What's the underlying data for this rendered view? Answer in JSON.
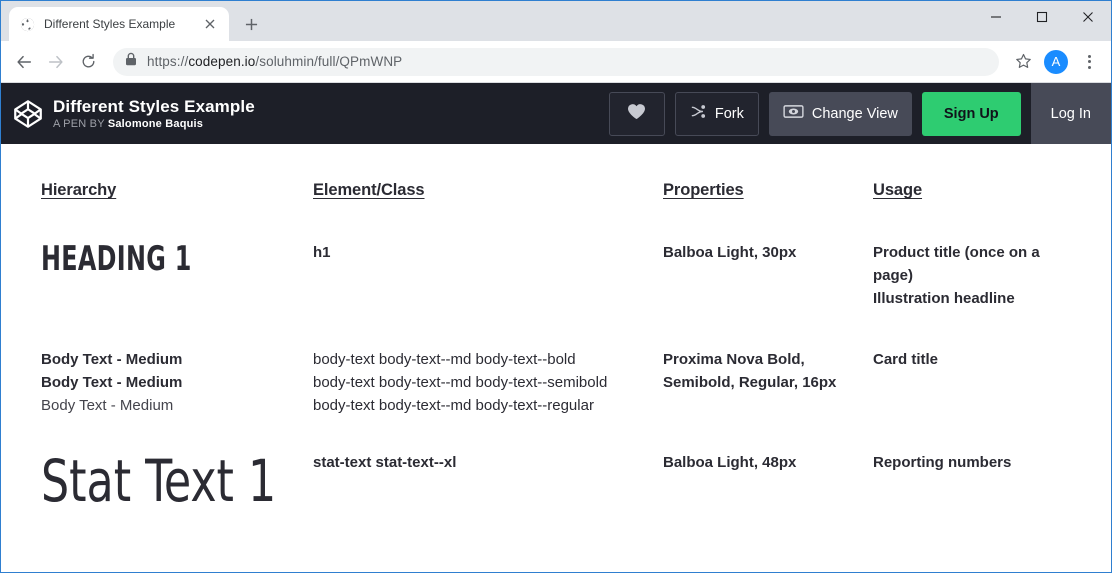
{
  "browser": {
    "tab": {
      "title": "Different Styles Example",
      "favicon_icon": "globe-icon",
      "close_icon": "close-icon"
    },
    "new_tab_icon": "plus-icon",
    "window_controls": {
      "minimize_icon": "minimize-icon",
      "maximize_icon": "maximize-icon",
      "close_icon": "window-close-icon"
    },
    "toolbar": {
      "back_icon": "back-arrow-icon",
      "forward_icon": "forward-arrow-icon",
      "reload_icon": "reload-icon",
      "lock_icon": "lock-icon",
      "url_scheme": "https://",
      "url_domain": "codepen.io",
      "url_path": "/soluhmin/full/QPmWNP",
      "url_full": "https://codepen.io/soluhmin/full/QPmWNP",
      "bookmark_icon": "star-icon",
      "avatar_letter": "A",
      "menu_icon": "kebab-menu-icon"
    }
  },
  "codepen_header": {
    "logo_icon": "codepen-logo-icon",
    "title": "Different Styles Example",
    "byline_prefix": "A PEN BY",
    "author": "Salomone Baquis",
    "actions": {
      "heart_icon": "heart-icon",
      "fork_icon": "fork-icon",
      "fork_label": "Fork",
      "change_view_icon": "eye-icon",
      "change_view_label": "Change View",
      "sign_up_label": "Sign Up",
      "log_in_label": "Log In"
    },
    "colors": {
      "background": "#1d1f28",
      "button_grey": "#474a57",
      "signup_green": "#2ecc71"
    }
  },
  "pen": {
    "columns": [
      "Hierarchy",
      "Element/Class",
      "Properties",
      "Usage"
    ],
    "rows": [
      {
        "hierarchy": [
          "HEADING 1"
        ],
        "element_class": [
          "h1"
        ],
        "properties": [
          "Balboa Light, 30px"
        ],
        "usage": [
          "Product title (once on a",
          "page)",
          "Illustration headline"
        ]
      },
      {
        "hierarchy": [
          "Body Text - Medium",
          "Body Text - Medium",
          "Body Text - Medium"
        ],
        "element_class": [
          "body-text body-text--md body-text--bold",
          "body-text body-text--md body-text--semibold",
          "body-text body-text--md body-text--regular"
        ],
        "properties": [
          "Proxima Nova Bold,",
          "Semibold, Regular, 16px"
        ],
        "usage": [
          "Card title"
        ]
      },
      {
        "hierarchy": [
          "Stat Text 1"
        ],
        "element_class": [
          "stat-text stat-text--xl"
        ],
        "properties": [
          "Balboa Light, 48px"
        ],
        "usage": [
          "Reporting numbers"
        ]
      }
    ]
  }
}
